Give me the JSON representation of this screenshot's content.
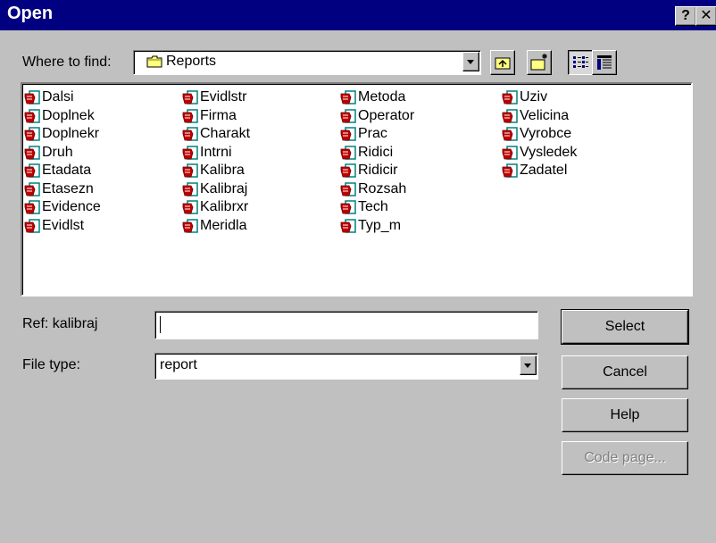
{
  "window": {
    "title": "Open",
    "help_glyph": "?",
    "close_glyph": "✕"
  },
  "lookin": {
    "label": "Where to find:",
    "value": "Reports"
  },
  "files": [
    "Dalsi",
    "Doplnek",
    "Doplnekr",
    "Druh",
    "Etadata",
    "Etasezn",
    "Evidence",
    "Evidlst",
    "Evidlstr",
    "Firma",
    "Charakt",
    "Intrni",
    "Kalibra",
    "Kalibraj",
    "Kalibrxr",
    "Meridla",
    "Metoda",
    "Operator",
    "Prac",
    "Ridici",
    "Ridicir",
    "Rozsah",
    "Tech",
    "Typ_m",
    "Uziv",
    "Velicina",
    "Vyrobce",
    "Vysledek",
    "Zadatel"
  ],
  "ref": {
    "label": "Ref: kalibraj",
    "value": ""
  },
  "filetype": {
    "label": "File type:",
    "value": "report"
  },
  "buttons": {
    "select": "Select",
    "cancel": "Cancel",
    "help": "Help",
    "codepage": "Code page..."
  },
  "colors": {
    "titlebar": "#000080",
    "face": "#c0c0c0",
    "icon_red": "#c00000",
    "icon_teal": "#008080"
  }
}
